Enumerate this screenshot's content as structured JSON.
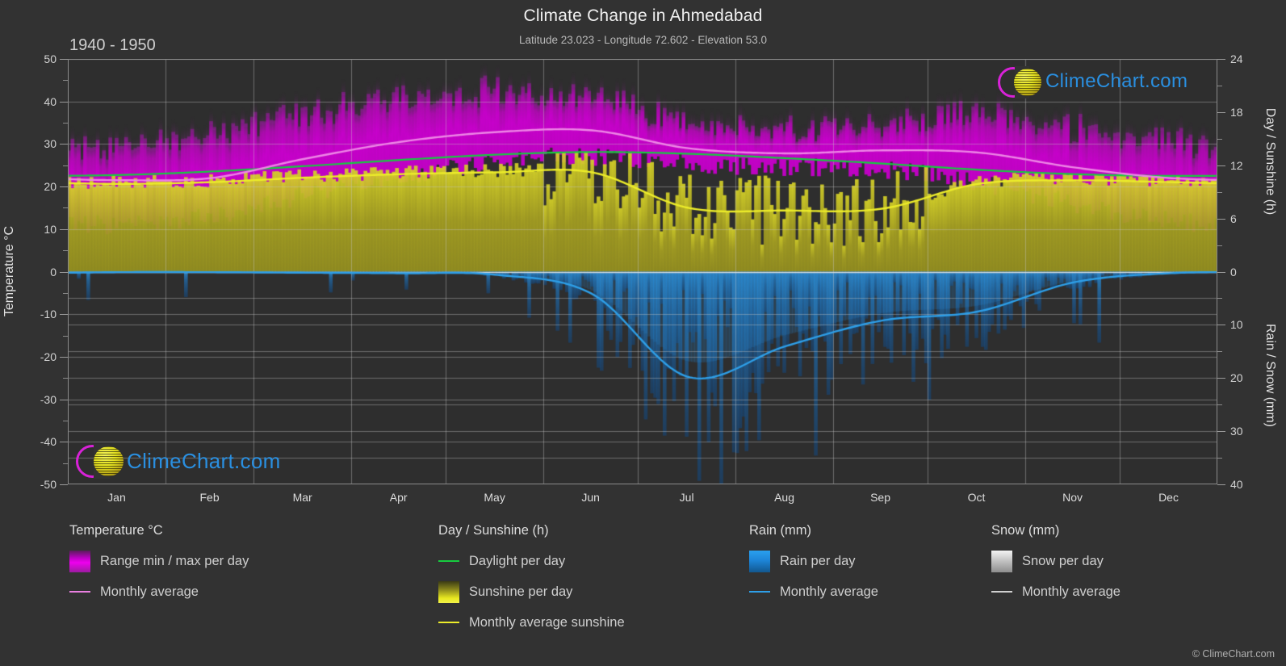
{
  "header": {
    "title": "Climate Change in Ahmedabad",
    "subtitle": "Latitude 23.023 - Longitude 72.602 - Elevation 53.0",
    "period": "1940 - 1950"
  },
  "branding": {
    "logo_text": "ClimeChart.com",
    "copyright": "© ClimeChart.com"
  },
  "axes": {
    "left_title": "Temperature °C",
    "right_title_top": "Day / Sunshine (h)",
    "right_title_bottom": "Rain / Snow (mm)",
    "left_ticks": [
      "50",
      "40",
      "30",
      "20",
      "10",
      "0",
      "-10",
      "-20",
      "-30",
      "-40",
      "-50"
    ],
    "right_ticks_top": [
      "24",
      "18",
      "12",
      "6",
      "0"
    ],
    "right_ticks_bottom": [
      "10",
      "20",
      "30",
      "40"
    ],
    "x_ticks": [
      "Jan",
      "Feb",
      "Mar",
      "Apr",
      "May",
      "Jun",
      "Jul",
      "Aug",
      "Sep",
      "Oct",
      "Nov",
      "Dec"
    ]
  },
  "legend": {
    "groups": [
      {
        "title": "Temperature °C",
        "items": [
          {
            "label": "Range min / max per day",
            "swatch": "gradient-magenta",
            "color": "#d400d4"
          },
          {
            "label": "Monthly average",
            "swatch": "line",
            "color": "#e97fe0"
          }
        ]
      },
      {
        "title": "Day / Sunshine (h)",
        "items": [
          {
            "label": "Daylight per day",
            "swatch": "line",
            "color": "#17cc3f"
          },
          {
            "label": "Sunshine per day",
            "swatch": "gradient-yellow",
            "color": "#e8e820"
          },
          {
            "label": "Monthly average sunshine",
            "swatch": "line",
            "color": "#ecec2a"
          }
        ]
      },
      {
        "title": "Rain (mm)",
        "items": [
          {
            "label": "Rain per day",
            "swatch": "gradient-blue",
            "color": "#1f8fe8"
          },
          {
            "label": "Monthly average",
            "swatch": "line",
            "color": "#2e9fe8"
          }
        ]
      },
      {
        "title": "Snow (mm)",
        "items": [
          {
            "label": "Snow per day",
            "swatch": "gradient-white",
            "color": "#e0e0e0"
          },
          {
            "label": "Monthly average",
            "swatch": "line",
            "color": "#d0d0d0"
          }
        ]
      }
    ]
  },
  "chart_data": {
    "type": "area",
    "title": "Climate Change in Ahmedabad",
    "subtitle": "Latitude 23.023 - Longitude 72.602 - Elevation 53.0",
    "period": "1940 - 1950",
    "xlabel": "",
    "x": [
      "Jan",
      "Feb",
      "Mar",
      "Apr",
      "May",
      "Jun",
      "Jul",
      "Aug",
      "Sep",
      "Oct",
      "Nov",
      "Dec"
    ],
    "left_axis": {
      "label": "Temperature °C",
      "min": -50,
      "max": 50,
      "step": 10,
      "unit": "°C"
    },
    "right_axis_top": {
      "label": "Day / Sunshine (h)",
      "min": 0,
      "max": 24,
      "step": 6,
      "unit": "h"
    },
    "right_axis_bottom": {
      "label": "Rain / Snow (mm)",
      "min": 0,
      "max": 40,
      "step": 10,
      "unit": "mm"
    },
    "grid": true,
    "legend_position": "below",
    "series": [
      {
        "name": "Monthly average temperature",
        "unit": "°C",
        "axis": "left",
        "color": "#e97fe0",
        "values": [
          21.5,
          22.0,
          26.5,
          30.5,
          32.8,
          33.2,
          29.0,
          27.8,
          28.5,
          28.0,
          24.5,
          22.0
        ]
      },
      {
        "name": "Range max per day",
        "unit": "°C",
        "axis": "left",
        "color": "#d400d4",
        "values": [
          30.0,
          32.0,
          37.0,
          41.0,
          42.0,
          41.0,
          35.0,
          33.0,
          35.0,
          37.0,
          33.5,
          30.5
        ]
      },
      {
        "name": "Range min per day",
        "unit": "°C",
        "axis": "left",
        "color": "#d400d4",
        "values": [
          11.0,
          13.0,
          18.0,
          22.0,
          26.0,
          27.0,
          25.5,
          24.5,
          24.0,
          21.0,
          16.0,
          12.0
        ]
      },
      {
        "name": "Daylight per day",
        "unit": "h",
        "axis": "right_top",
        "color": "#17cc3f",
        "values": [
          10.9,
          11.3,
          11.9,
          12.6,
          13.2,
          13.5,
          13.3,
          12.8,
          12.2,
          11.5,
          11.0,
          10.8
        ]
      },
      {
        "name": "Monthly average sunshine",
        "unit": "h",
        "axis": "right_top",
        "color": "#ecec2a",
        "values": [
          9.9,
          10.1,
          10.6,
          11.0,
          11.2,
          11.2,
          7.2,
          6.9,
          7.1,
          9.9,
          10.3,
          10.1
        ]
      },
      {
        "name": "Rain monthly average",
        "unit": "mm",
        "axis": "right_bottom",
        "color": "#2e9fe8",
        "values": [
          0.1,
          0.1,
          0.2,
          0.3,
          0.6,
          4.2,
          19.8,
          14.0,
          9.2,
          7.5,
          2.0,
          0.3
        ]
      },
      {
        "name": "Snow monthly average",
        "unit": "mm",
        "axis": "right_bottom",
        "color": "#d0d0d0",
        "values": [
          0,
          0,
          0,
          0,
          0,
          0,
          0,
          0,
          0,
          0,
          0,
          0
        ]
      }
    ]
  }
}
